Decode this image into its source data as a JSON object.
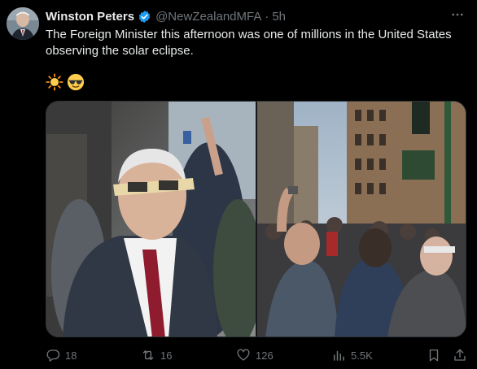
{
  "author": {
    "name": "Winston Peters",
    "handle": "@NewZealandMFA",
    "separator": "·",
    "time": "5h"
  },
  "tweet": {
    "text": "The Foreign Minister this afternoon was one of millions in the United States observing the solar eclipse.",
    "emojis": [
      "sun-emoji",
      "sunglasses-face-emoji"
    ]
  },
  "media": {
    "photos": [
      "photo-minister-eclipse-glasses",
      "photo-crowd-street-eclipse"
    ]
  },
  "actions": {
    "replies": "18",
    "reposts": "16",
    "likes": "126",
    "views": "5.5K"
  },
  "colors": {
    "background": "#000000",
    "text": "#e7e9ea",
    "muted": "#71767b",
    "verified": "#1d9bf0",
    "border": "#2f3336"
  }
}
